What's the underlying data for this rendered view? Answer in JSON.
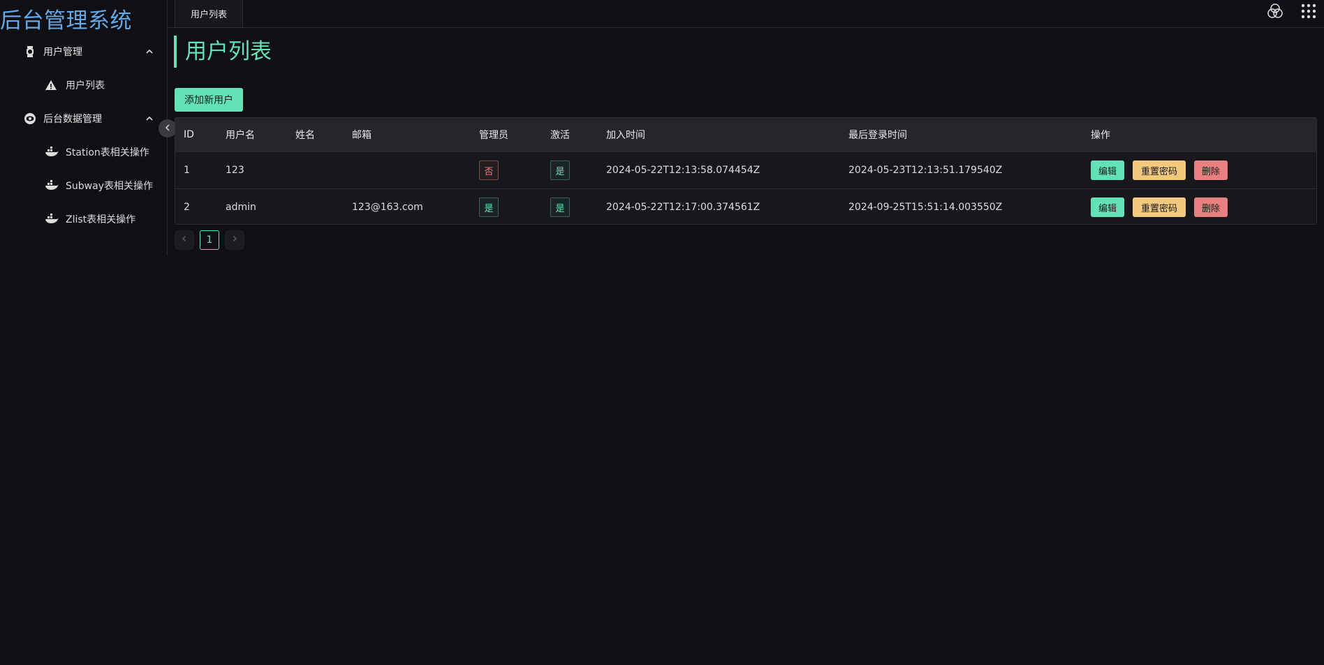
{
  "app": {
    "title": "后台管理系统"
  },
  "sidebar": {
    "groups": [
      {
        "label": "用户管理",
        "icon": "watch-icon",
        "items": [
          {
            "label": "用户列表",
            "icon": "warning-icon"
          }
        ]
      },
      {
        "label": "后台数据管理",
        "icon": "eye-icon",
        "items": [
          {
            "label": "Station表相关操作",
            "icon": "docker-icon"
          },
          {
            "label": "Subway表相关操作",
            "icon": "docker-icon"
          },
          {
            "label": "Zlist表相关操作",
            "icon": "docker-icon"
          }
        ]
      }
    ]
  },
  "tabs": [
    {
      "label": "用户列表"
    }
  ],
  "main": {
    "title": "用户列表",
    "add_button": "添加新用户",
    "table": {
      "headers": [
        "ID",
        "用户名",
        "姓名",
        "邮箱",
        "管理员",
        "激活",
        "加入时间",
        "最后登录时间",
        "操作"
      ],
      "rows": [
        {
          "id": "1",
          "username": "123",
          "name": "",
          "email": "",
          "admin": "否",
          "active": "是",
          "joined": "2024-05-22T12:13:58.074454Z",
          "last_login": "2024-05-23T12:13:51.179540Z"
        },
        {
          "id": "2",
          "username": "admin",
          "name": "",
          "email": "123@163.com",
          "admin": "是",
          "active": "是",
          "joined": "2024-05-22T12:17:00.374561Z",
          "last_login": "2024-09-25T15:51:14.003550Z"
        }
      ],
      "actions": {
        "edit": "编辑",
        "reset": "重置密码",
        "delete": "删除"
      }
    },
    "pagination": {
      "current": "1"
    }
  },
  "colors": {
    "accent": "#63e2b7",
    "title_blue": "#63a9e8",
    "warning": "#f2c97d",
    "error": "#e88080",
    "background": "#101014"
  }
}
